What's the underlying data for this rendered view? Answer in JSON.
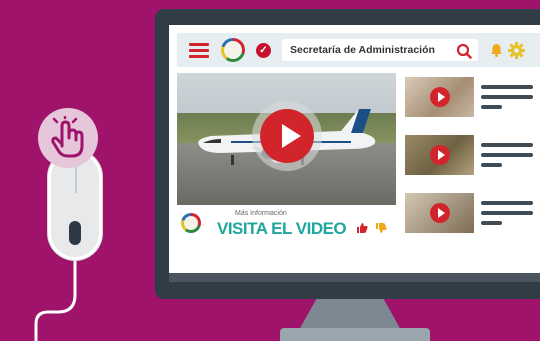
{
  "header": {
    "search_text": "Secretaría de Administración"
  },
  "main_video": {
    "caption_small": "Más Información",
    "caption_big": "VISITA EL VIDEO"
  },
  "side_videos": [
    {
      "thumb_color": "#b7a693"
    },
    {
      "thumb_color": "#8f7e61"
    },
    {
      "thumb_color": "#c1b59f"
    }
  ],
  "colors": {
    "background": "#a0136a",
    "accent_red": "#d2252b",
    "caption_teal": "#1fa79e",
    "monitor": "#303c46"
  },
  "icons": [
    "menu-icon",
    "logo-emblem",
    "check-badge-icon",
    "search-icon",
    "bell-icon",
    "gear-icon",
    "play-icon",
    "thumb-up-icon",
    "thumb-down-icon",
    "hand-click-icon",
    "computer-mouse"
  ]
}
